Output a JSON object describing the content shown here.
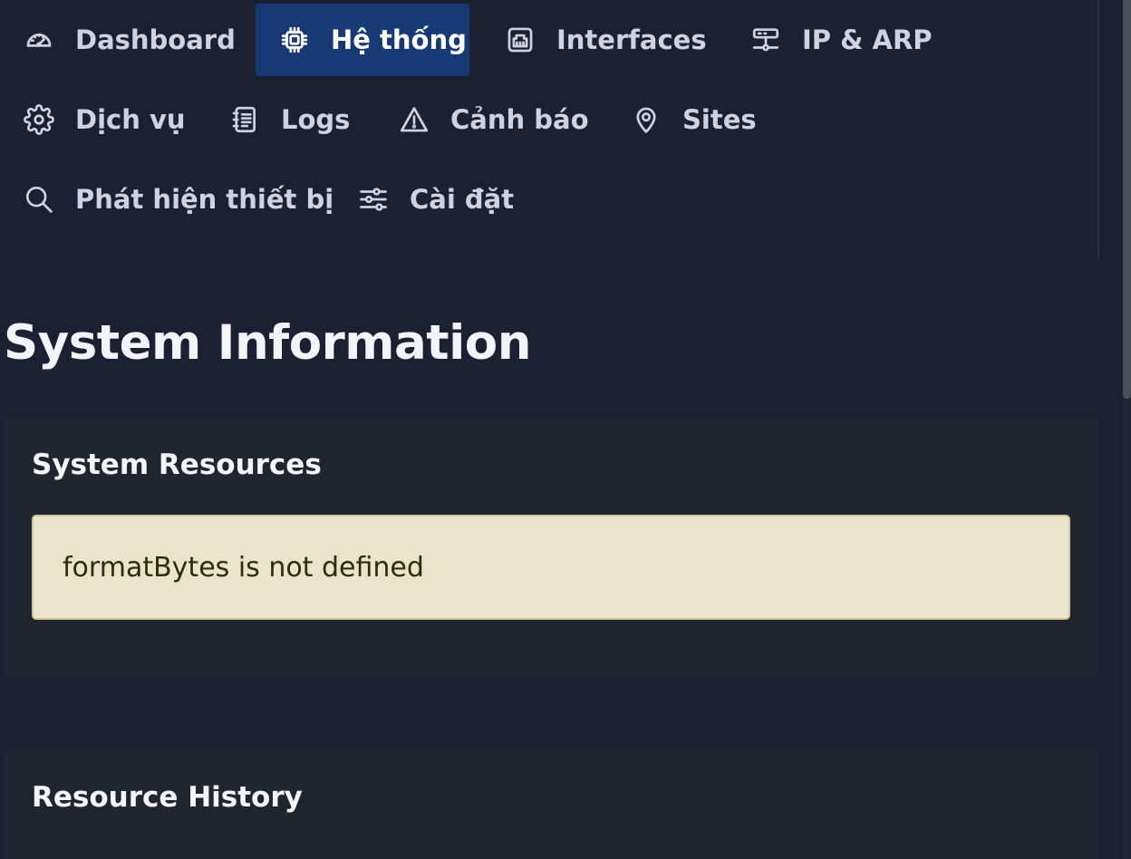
{
  "nav": {
    "items": [
      {
        "label": "Dashboard",
        "icon": "speedometer-icon",
        "active": false
      },
      {
        "label": "Hệ thống",
        "icon": "cpu-icon",
        "active": true
      },
      {
        "label": "Interfaces",
        "icon": "ethernet-icon",
        "active": false
      },
      {
        "label": "IP & ARP",
        "icon": "network-icon",
        "active": false
      },
      {
        "label": "Dịch vụ",
        "icon": "gear-icon",
        "active": false
      },
      {
        "label": "Logs",
        "icon": "journal-icon",
        "active": false
      },
      {
        "label": "Cảnh báo",
        "icon": "warning-icon",
        "active": false
      },
      {
        "label": "Sites",
        "icon": "map-pin-icon",
        "active": false
      },
      {
        "label": "Phát hiện thiết bị",
        "icon": "search-icon",
        "active": false
      },
      {
        "label": "Cài đặt",
        "icon": "sliders-icon",
        "active": false
      }
    ]
  },
  "main": {
    "title": "System Information",
    "system_resources": {
      "title": "System Resources",
      "error_message": "formatBytes is not defined"
    },
    "resource_history": {
      "title": "Resource History"
    }
  },
  "colors": {
    "background": "#1b2132",
    "card": "#212530",
    "active_nav": "#173a74",
    "alert_bg": "#ebe4cc",
    "alert_text": "#332a08"
  }
}
